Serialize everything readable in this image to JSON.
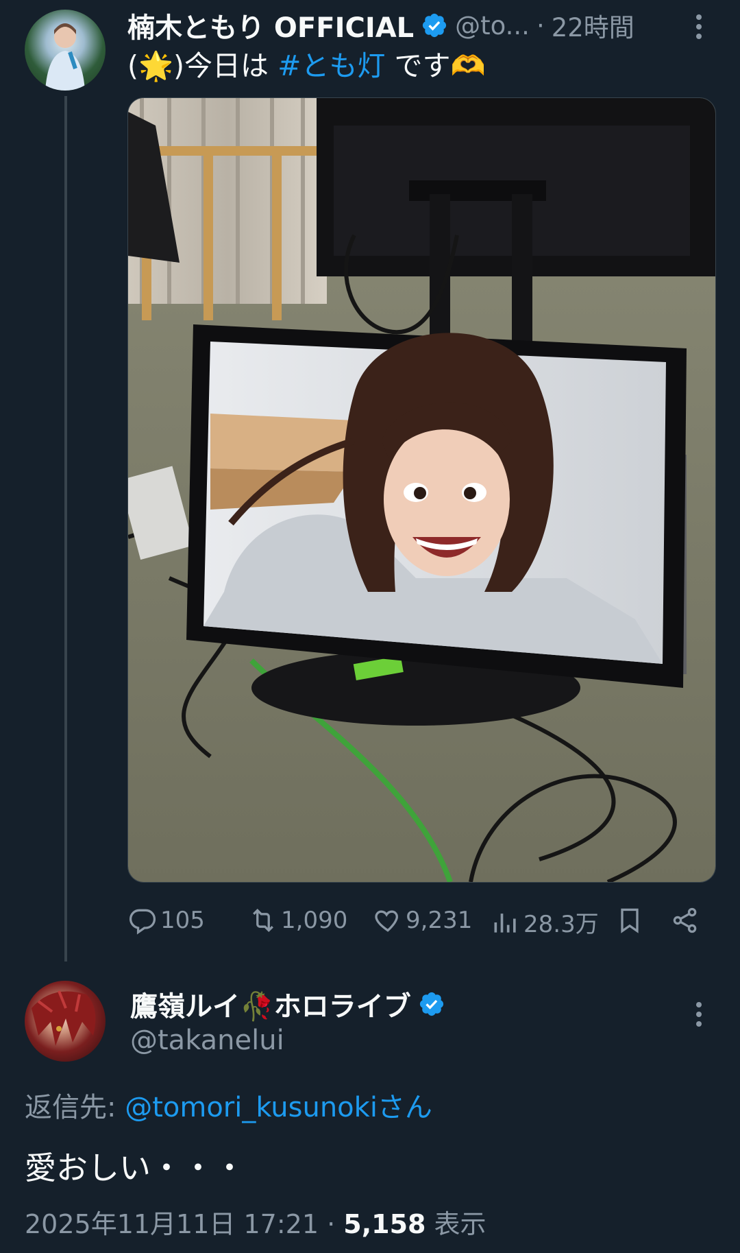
{
  "tweet": {
    "display_name": "楠木ともり OFFICIAL",
    "handle": "@to...",
    "separator": "·",
    "time_ago": "22時間",
    "text_prefix": "(🌟)今日は ",
    "hashtag": "#とも灯",
    "text_suffix": " です🫶",
    "stats": {
      "replies": "105",
      "retweets": "1,090",
      "likes": "9,231",
      "views": "28.3万"
    }
  },
  "reply": {
    "display_name": "鷹嶺ルイ🥀ホロライブ",
    "handle": "@takanelui",
    "reply_to_label": "返信先: ",
    "reply_to_user": "@tomori_kusunokiさん",
    "text": "愛おしい・・・",
    "date": "2025年11月11日 17:21",
    "dot": " · ",
    "view_count": "5,158",
    "view_label": " 表示"
  },
  "colors": {
    "background": "#15202b",
    "accent": "#1d9bf0",
    "secondary_text": "#8b98a5"
  }
}
